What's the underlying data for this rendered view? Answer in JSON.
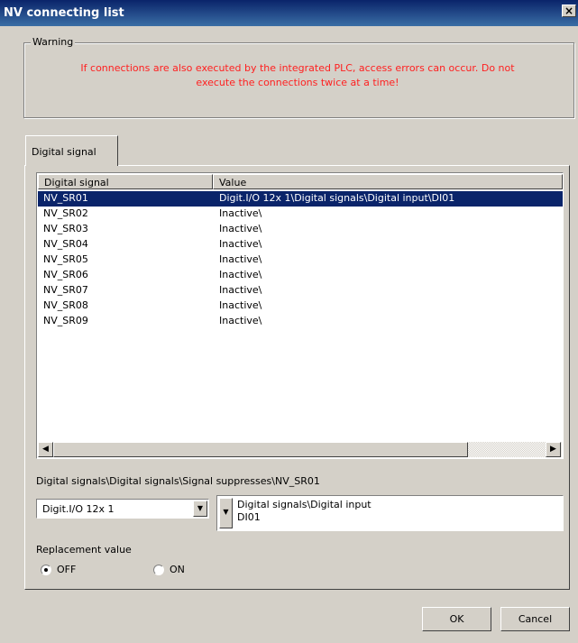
{
  "window": {
    "title": "NV connecting list",
    "close_label": "×"
  },
  "warning": {
    "group_label": "Warning",
    "line1": "If connections are also executed by the integrated PLC, access errors can occur. Do not",
    "line2": "execute the connections twice at a time!"
  },
  "tabs": [
    {
      "label": "Digital signal",
      "active": true
    }
  ],
  "table": {
    "columns": [
      "Digital signal",
      "Value"
    ],
    "rows": [
      {
        "signal": "NV_SR01",
        "value": "Digit.I/O 12x 1\\Digital signals\\Digital input\\DI01",
        "selected": true
      },
      {
        "signal": "NV_SR02",
        "value": "Inactive\\"
      },
      {
        "signal": "NV_SR03",
        "value": "Inactive\\"
      },
      {
        "signal": "NV_SR04",
        "value": "Inactive\\"
      },
      {
        "signal": "NV_SR05",
        "value": "Inactive\\"
      },
      {
        "signal": "NV_SR06",
        "value": "Inactive\\"
      },
      {
        "signal": "NV_SR07",
        "value": "Inactive\\"
      },
      {
        "signal": "NV_SR08",
        "value": "Inactive\\"
      },
      {
        "signal": "NV_SR09",
        "value": "Inactive\\"
      }
    ]
  },
  "path_label": "Digital signals\\Digital signals\\Signal suppresses\\NV_SR01",
  "module_select": {
    "value": "Digit.I/O 12x 1"
  },
  "value_box": {
    "line1": "Digital signals\\Digital input",
    "line2": "DI01"
  },
  "replacement": {
    "label": "Replacement value",
    "options": [
      {
        "label": "OFF",
        "checked": true
      },
      {
        "label": "ON",
        "checked": false
      }
    ]
  },
  "buttons": {
    "ok": "OK",
    "cancel": "Cancel"
  },
  "colors": {
    "title_bar": "#0a246a",
    "selection": "#0a246a",
    "warning_text": "#ff2020",
    "face": "#d4d0c8"
  }
}
